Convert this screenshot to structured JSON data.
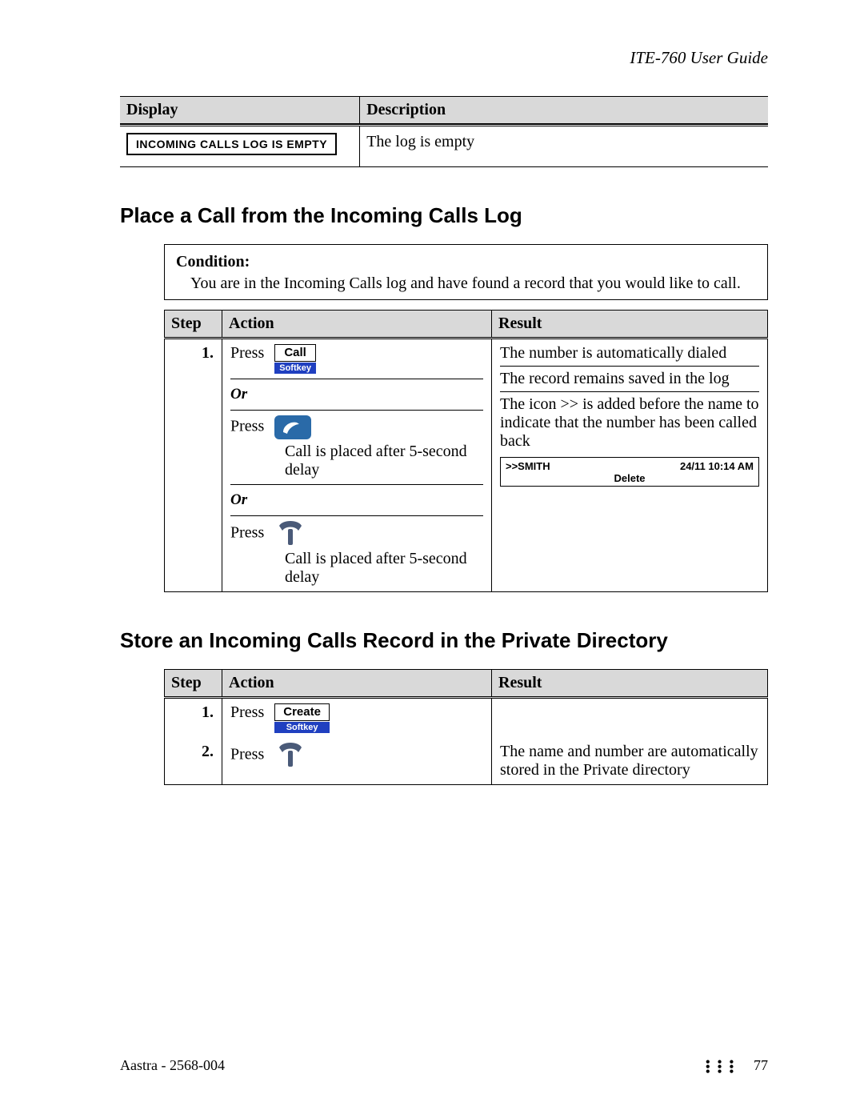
{
  "header": {
    "guide": "ITE-760 User Guide"
  },
  "table_display": {
    "col1": "Display",
    "col2": "Description",
    "lcd_text": "INCOMING CALLS LOG IS EMPTY",
    "desc": "The log is empty"
  },
  "section1": {
    "title": "Place a Call from the Incoming Calls Log",
    "condition_label": "Condition:",
    "condition_text": "You are in the Incoming Calls log and have found a record that you would like to call.",
    "cols": {
      "step": "Step",
      "action": "Action",
      "result": "Result"
    },
    "step1": {
      "num": "1.",
      "press": "Press",
      "softkey_call": "Call",
      "softkey_label": "Softkey",
      "or": "Or",
      "delay": "Call is placed after 5-second delay",
      "result1": "The number is automatically dialed",
      "result2": "The record remains saved in the log",
      "result3": "The icon >> is added before the name to indicate that the number has been called back",
      "smith_name": ">>SMITH",
      "smith_time": "24/11 10:14 AM",
      "smith_delete": "Delete"
    }
  },
  "section2": {
    "title": "Store an Incoming Calls Record in the Private Directory",
    "cols": {
      "step": "Step",
      "action": "Action",
      "result": "Result"
    },
    "step1": {
      "num": "1.",
      "press": "Press",
      "softkey_create": "Create",
      "softkey_label": "Softkey"
    },
    "step2": {
      "num": "2.",
      "press": "Press",
      "result": "The name and number are automatically stored in the Private directory"
    }
  },
  "footer": {
    "left": "Aastra - 2568-004",
    "page": "77"
  }
}
